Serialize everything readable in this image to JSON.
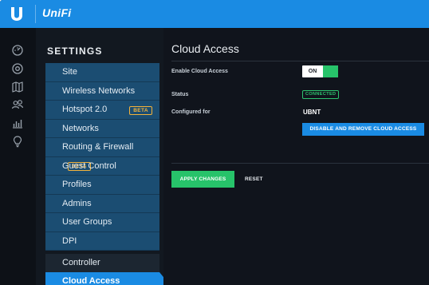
{
  "app": {
    "brand": "UniFi",
    "accent": "#1a8be3",
    "success": "#27c36a"
  },
  "rail": {
    "icons": [
      "dashboard-icon",
      "devices-icon",
      "map-icon",
      "clients-icon",
      "statistics-icon",
      "insights-icon"
    ]
  },
  "settings": {
    "title": "SETTINGS",
    "items": [
      {
        "label": "Site"
      },
      {
        "label": "Wireless Networks"
      },
      {
        "label": "Hotspot 2.0",
        "badge": "BETA"
      },
      {
        "label": "Networks"
      },
      {
        "label": "Routing & Firewall",
        "badge": "BETA"
      },
      {
        "label": "Guest Control"
      },
      {
        "label": "Profiles"
      },
      {
        "label": "Admins"
      },
      {
        "label": "User Groups"
      },
      {
        "label": "DPI"
      }
    ],
    "controller": "Controller",
    "active": "Cloud Access"
  },
  "main": {
    "title": "Cloud Access",
    "enable_label": "Enable Cloud Access",
    "toggle_on": "ON",
    "status_label": "Status",
    "status_value": "CONNECTED",
    "configured_label": "Configured for",
    "configured_value": "UBNT",
    "disable_button": "DISABLE AND REMOVE CLOUD ACCESS",
    "apply_button": "APPLY CHANGES",
    "reset_button": "RESET"
  }
}
